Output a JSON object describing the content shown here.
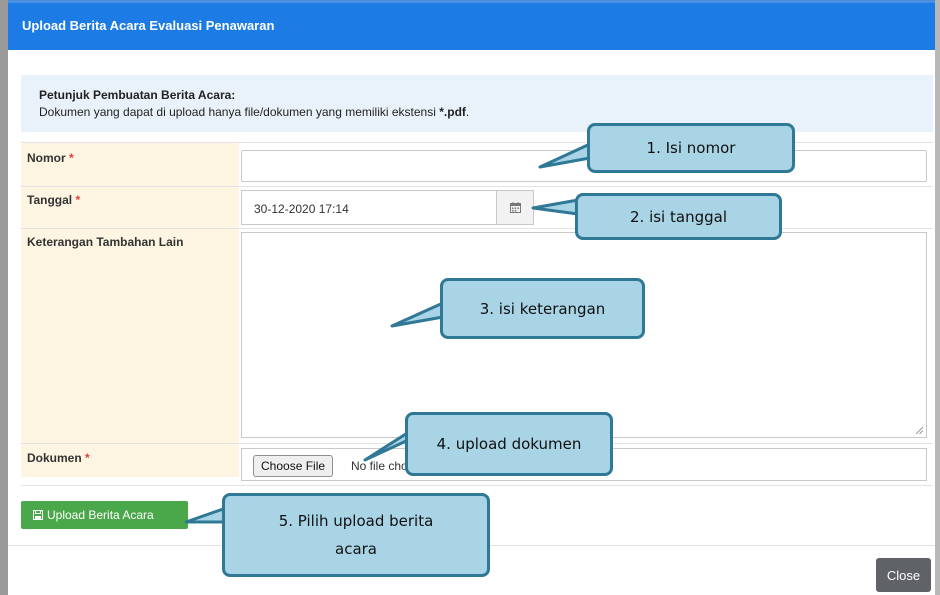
{
  "modal": {
    "title": "Upload Berita Acara Evaluasi Penawaran",
    "close_label": "Close"
  },
  "info": {
    "title": "Petunjuk Pembuatan Berita Acara:",
    "text": "Dokumen yang dapat di upload hanya file/dokumen yang memiliki ekstensi ",
    "ext": "*.pdf",
    "suffix": "."
  },
  "form": {
    "nomor": {
      "label": "Nomor",
      "required": "*",
      "value": ""
    },
    "tanggal": {
      "label": "Tanggal",
      "required": "*",
      "value": "30-12-2020 17:14"
    },
    "keterangan": {
      "label": "Keterangan Tambahan Lain",
      "value": ""
    },
    "dokumen": {
      "label": "Dokumen",
      "required": "*",
      "choose_label": "Choose File",
      "status": "No file chosen"
    },
    "submit_label": "Upload Berita Acara"
  },
  "annotations": {
    "c1": "1.   Isi nomor",
    "c2": "2. isi tanggal",
    "c3": "3. isi keterangan",
    "c4": "4. upload dokumen",
    "c5": "5. Pilih upload berita acara"
  },
  "colors": {
    "header": "#1d7be6",
    "submit": "#4aa84a",
    "close": "#5f6368",
    "callout_fill": "#a8d4e6",
    "callout_border": "#2f7896"
  }
}
